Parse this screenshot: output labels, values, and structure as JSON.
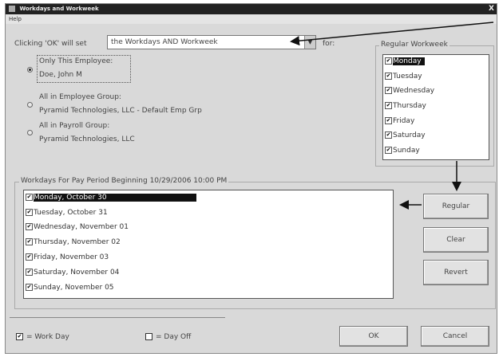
{
  "window": {
    "title": "Workdays and Workweek",
    "close_glyph": "X"
  },
  "menu": {
    "help": "Help"
  },
  "clicking": {
    "prefix": "Clicking 'OK' will set",
    "suffix": "for:"
  },
  "combo": {
    "value": "the Workdays AND Workweek"
  },
  "options": [
    {
      "label": "Only This Employee:",
      "value": "Doe, John M",
      "selected": true
    },
    {
      "label": "All in Employee Group:",
      "value": "Pyramid Technologies, LLC - Default Emp Grp",
      "selected": false
    },
    {
      "label": "All in Payroll Group:",
      "value": "Pyramid Technologies, LLC",
      "selected": false
    }
  ],
  "regular_workweek": {
    "title": "Regular Workweek",
    "days": [
      "Monday",
      "Tuesday",
      "Wednesday",
      "Thursday",
      "Friday",
      "Saturday",
      "Sunday"
    ]
  },
  "workdays": {
    "title": "Workdays For Pay Period Beginning 10/29/2006 10:00 PM",
    "days": [
      "Monday, October 30",
      "Tuesday, October 31",
      "Wednesday, November 01",
      "Thursday, November 02",
      "Friday, November 03",
      "Saturday, November 04",
      "Sunday, November 05"
    ]
  },
  "buttons": {
    "regular": "Regular",
    "clear": "Clear",
    "revert": "Revert",
    "ok": "OK",
    "cancel": "Cancel"
  },
  "key": {
    "work_day": "= Work Day",
    "day_off": "= Day Off"
  },
  "check_glyph": "✔"
}
